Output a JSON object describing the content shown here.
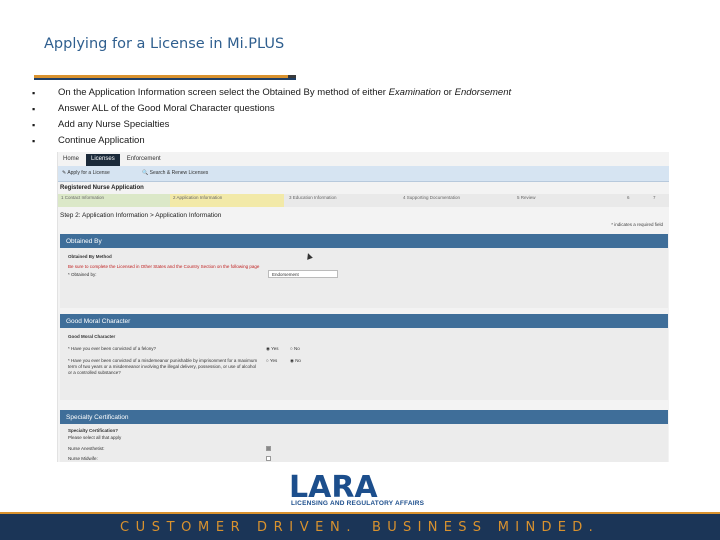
{
  "slide": {
    "title": "Applying for a License in Mi.PLUS",
    "bullets": [
      {
        "pre": "On the Application Information screen select the Obtained By method of either ",
        "em1": "Examination",
        "mid": " or ",
        "em2": "Endorsement"
      },
      {
        "pre": "Answer ALL of the Good Moral Character questions",
        "em1": "",
        "mid": "",
        "em2": ""
      },
      {
        "pre": "Add any Nurse Specialties",
        "em1": "",
        "mid": "",
        "em2": ""
      },
      {
        "pre": "Continue Application",
        "em1": "",
        "mid": "",
        "em2": ""
      }
    ],
    "bullet_glyph": "▪"
  },
  "app": {
    "tabs": [
      "Home",
      "Licenses",
      "Enforcement"
    ],
    "active_tab": "Licenses",
    "actions": [
      "Apply for a License",
      "Search & Renew Licenses"
    ],
    "application_title": "Registered Nurse Application",
    "steps": [
      "1 Contact Information",
      "2 Application Information",
      "3 Education Information",
      "4 Supporting Documentation",
      "5 Review",
      "6",
      "7"
    ],
    "breadcrumb": "Step 2: Application Information > Application Information",
    "required_note": "* indicates a required field",
    "obtained_by": {
      "header": "Obtained By",
      "section_label": "Obtained By Method",
      "warning": "Be sure to complete the Licensed in Other States and the Country Section on the following page",
      "field_label": "* Obtained by:",
      "selected_value": "Endorsement"
    },
    "good_moral": {
      "header": "Good Moral Character",
      "section_label": "Good Moral Character",
      "q1": "* Have you ever been convicted of a felony?",
      "q2": "* Have you ever been convicted of a misdemeanor punishable by imprisonment for a maximum term of two years or a misdemeanor involving the illegal delivery, possession, or use of alcohol or a controlled substance?",
      "yes": "Yes",
      "no": "No"
    },
    "specialty": {
      "header": "Specialty Certification",
      "section_label": "Specialty Certification?",
      "hint": "Please select all that apply",
      "items": [
        "Nurse Anesthetist:",
        "Nurse Midwife:"
      ]
    }
  },
  "logo": {
    "word": "LARA",
    "subtitle": "LICENSING AND REGULATORY AFFAIRS"
  },
  "footer": {
    "left": "CUSTOMER DRIVEN.",
    "right": "BUSINESS MINDED."
  },
  "colors": {
    "accent_orange": "#d9922e",
    "navy": "#1b3557",
    "panel_blue": "#3f6e99",
    "title_blue": "#2f5f8f"
  }
}
